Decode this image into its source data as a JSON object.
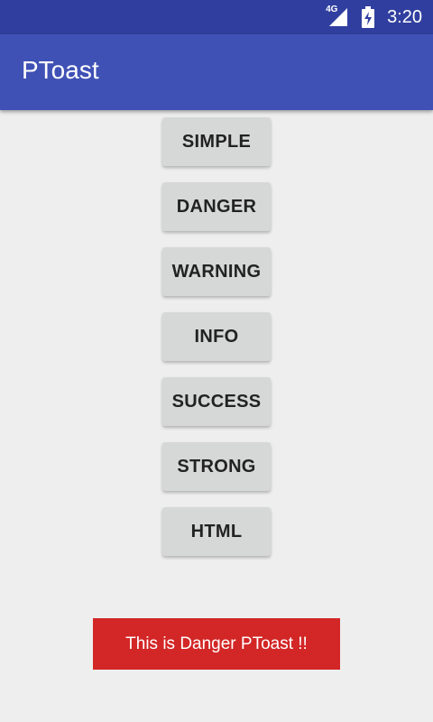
{
  "status_bar": {
    "network": "4G",
    "time": "3:20",
    "icons": [
      "signal-icon",
      "battery-charging-icon"
    ]
  },
  "app_bar": {
    "title": "PToast",
    "color": "#3f51b5",
    "status_color": "#303f9f"
  },
  "buttons": [
    {
      "label": "SIMPLE"
    },
    {
      "label": "DANGER"
    },
    {
      "label": "WARNING"
    },
    {
      "label": "INFO"
    },
    {
      "label": "SUCCESS"
    },
    {
      "label": "STRONG"
    },
    {
      "label": "HTML"
    }
  ],
  "toast": {
    "message": "This is Danger PToast !!",
    "color": "#d32626"
  }
}
